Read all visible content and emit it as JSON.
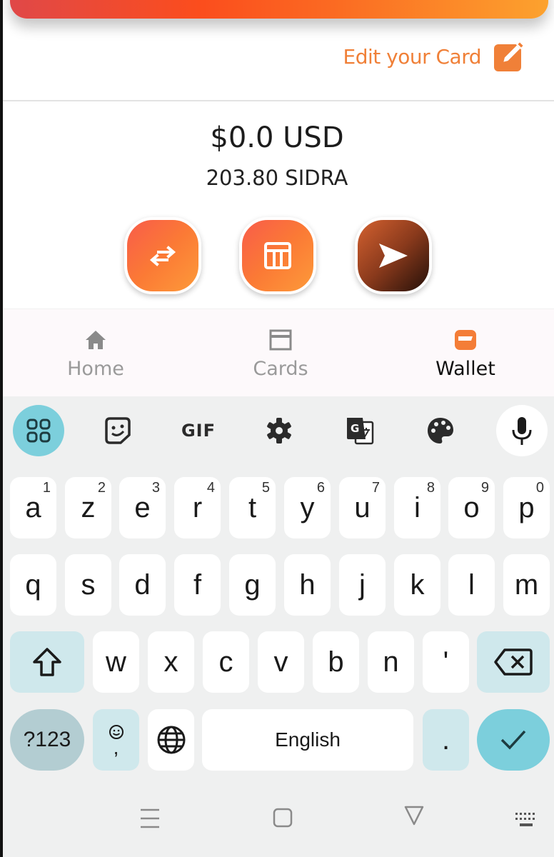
{
  "app": {
    "edit_card_label": "Edit your Card",
    "balance_usd": "$0.0 USD",
    "balance_token": "203.80 SIDRA",
    "actions": [
      {
        "name": "swap",
        "icon": "swap-arrows-icon"
      },
      {
        "name": "table",
        "icon": "table-icon"
      },
      {
        "name": "send",
        "icon": "send-icon"
      }
    ],
    "bottom_nav": [
      {
        "label": "Home",
        "icon": "home-icon",
        "active": false
      },
      {
        "label": "Cards",
        "icon": "card-icon",
        "active": false
      },
      {
        "label": "Wallet",
        "icon": "wallet-icon",
        "active": true
      }
    ],
    "colors": {
      "accent": "#f08038",
      "banner_start": "#e04848",
      "banner_end": "#fca22e",
      "send_dark": "#241009"
    }
  },
  "keyboard": {
    "toolbar": [
      {
        "icon": "apps-grid-icon"
      },
      {
        "icon": "sticker-icon"
      },
      {
        "icon": "gif-icon",
        "label": "GIF"
      },
      {
        "icon": "gear-icon"
      },
      {
        "icon": "translate-icon"
      },
      {
        "icon": "palette-icon"
      },
      {
        "icon": "microphone-icon"
      }
    ],
    "row1": [
      {
        "key": "a",
        "hint": "1"
      },
      {
        "key": "z",
        "hint": "2"
      },
      {
        "key": "e",
        "hint": "3"
      },
      {
        "key": "r",
        "hint": "4"
      },
      {
        "key": "t",
        "hint": "5"
      },
      {
        "key": "y",
        "hint": "6"
      },
      {
        "key": "u",
        "hint": "7"
      },
      {
        "key": "i",
        "hint": "8"
      },
      {
        "key": "o",
        "hint": "9"
      },
      {
        "key": "p",
        "hint": "0"
      }
    ],
    "row2": [
      "q",
      "s",
      "d",
      "f",
      "g",
      "h",
      "j",
      "k",
      "l",
      "m"
    ],
    "row3": [
      "w",
      "x",
      "c",
      "v",
      "b",
      "n",
      "'"
    ],
    "symbols_label": "?123",
    "comma_label": ",",
    "space_label": "English",
    "period_label": ".",
    "accent": "#7ccfdc"
  },
  "system_nav": [
    {
      "icon": "recents-icon"
    },
    {
      "icon": "home-square-icon"
    },
    {
      "icon": "back-triangle-icon"
    },
    {
      "icon": "keyboard-switch-icon"
    }
  ]
}
